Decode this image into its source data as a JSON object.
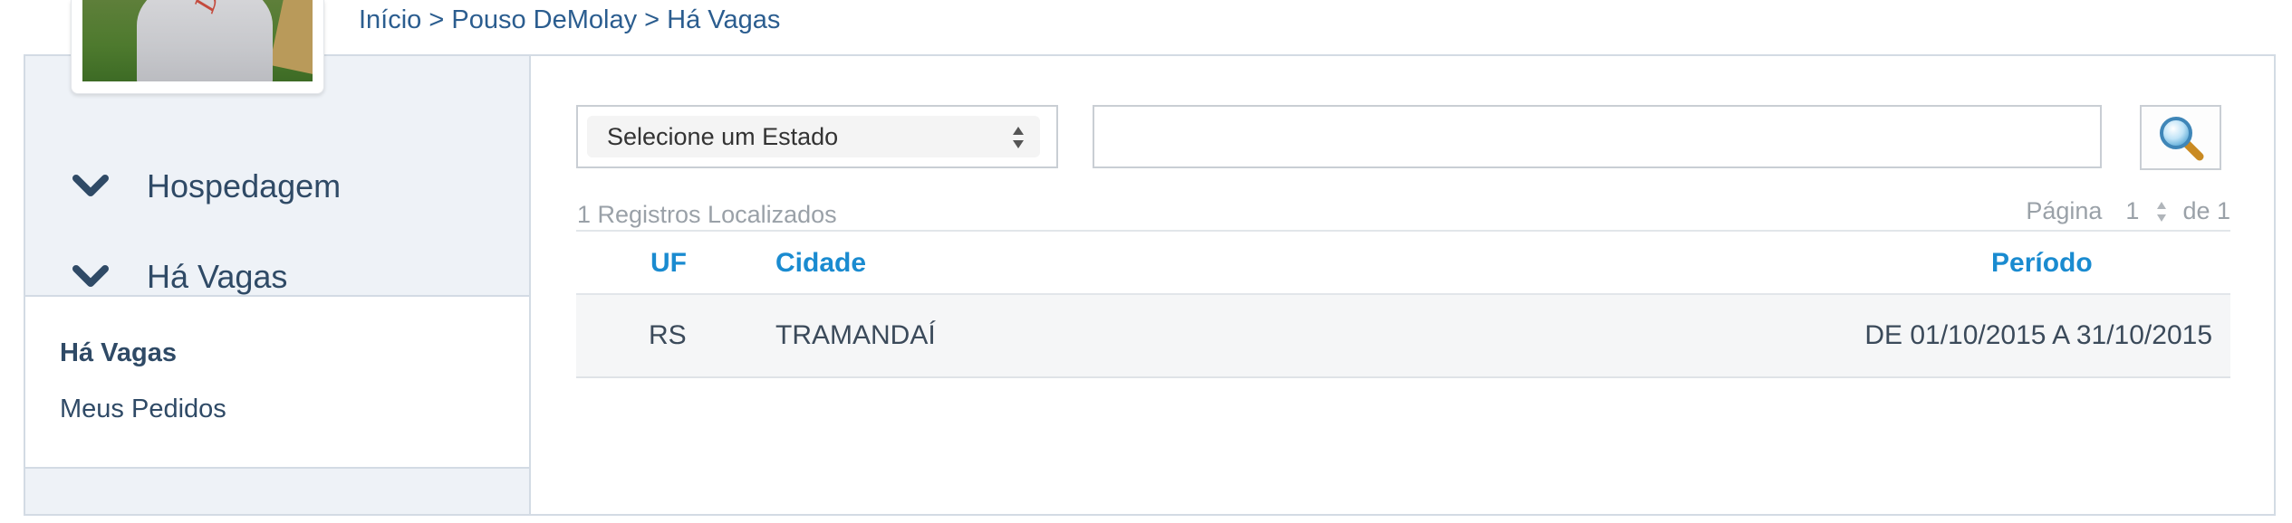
{
  "breadcrumb": "Início > Pouso DeMolay > Há Vagas",
  "avatar": {
    "shirt_text": "DeMolay"
  },
  "sidebar": {
    "menu": [
      {
        "label": "Hospedagem",
        "icon": "chevron-down-icon"
      },
      {
        "label": "Há Vagas",
        "icon": "chevron-down-icon"
      }
    ],
    "submenu": [
      {
        "label": "Há Vagas",
        "active": true
      },
      {
        "label": "Meus Pedidos",
        "active": false
      }
    ]
  },
  "filters": {
    "state_select": "Selecione um Estado",
    "search_value": "",
    "search_icon": "magnifier-icon"
  },
  "results": {
    "count_text": "1 Registros Localizados",
    "pagination": {
      "label": "Página",
      "current": "1",
      "of_label": "de 1"
    }
  },
  "table": {
    "headers": {
      "uf": "UF",
      "cidade": "Cidade",
      "periodo": "Período"
    },
    "rows": [
      {
        "uf": "RS",
        "cidade": "TRAMANDAÍ",
        "periodo": "DE 01/10/2015 A 31/10/2015"
      }
    ]
  },
  "colors": {
    "accent": "#1a8bd0",
    "nav_text": "#2f4a66",
    "panel_bg": "#eef2f7"
  }
}
